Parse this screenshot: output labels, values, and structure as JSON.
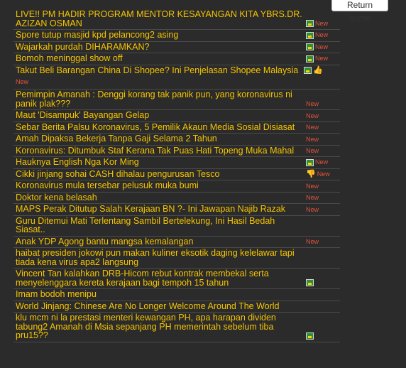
{
  "return_home": "Return home",
  "rows": [
    {
      "title": "LIVE!! PM HADIR PROGRAM MENTOR KESAYANGAN KITA YBRS.DR. AZIZAN OSMAN",
      "icon": "picture-icon",
      "new": "New"
    },
    {
      "title": "Spore tutup masjid kpd pelancong2 asing",
      "icon": "picture-icon",
      "new": "New"
    },
    {
      "title": "Wajarkah purdah DIHARAMKAN?",
      "icon": "picture-icon",
      "new": "New"
    },
    {
      "title": "Bomoh meninggal show off",
      "icon": "picture-icon",
      "new": "New"
    },
    {
      "title": "Takut Beli Barangan China Di Shopee? Ini Penjelasan Shopee Malaysia",
      "icon": "picture-icon",
      "icon2": "thumbs-up-icon",
      "new": "New"
    },
    {
      "title": "Pemimpin Amanah : Denggi korang tak panik pun, yang koronavirus ni panik plak???",
      "new": "New"
    },
    {
      "title": "Maut 'Disampuk' Bayangan Gelap",
      "new": "New"
    },
    {
      "title": "Sebar Berita Palsu Koronavirus, 5 Pemilik Akaun Media Sosial Disiasat",
      "new": "New"
    },
    {
      "title": "Amah Dipaksa Bekerja Tanpa Gaji Selama 2 Tahun",
      "new": "New"
    },
    {
      "title": "Koronavirus: Ditumbuk Staf Kerana Tak Puas Hati Topeng Muka Mahal",
      "new": "New"
    },
    {
      "title": "Hauknya English Nga Kor Ming",
      "icon": "picture-icon",
      "new": "New"
    },
    {
      "title": "Cikki jinjang sohai CASH dihalau pengurusan Tesco",
      "icon": "thumbs-down-icon",
      "new": "New"
    },
    {
      "title": "Koronavirus mula tersebar pelusuk muka bumi",
      "new": "New"
    },
    {
      "title": "Doktor kena belasah",
      "new": "New"
    },
    {
      "title": "MAPS Perak Ditutup Salah Kerajaan BN ?- Ini Jawapan Najib Razak",
      "new": "New"
    },
    {
      "title": "Guru Ditemui Mati Terlentang Sambil Bertelekung, Ini Hasil Bedah Siasat.."
    },
    {
      "title": "Anak YDP Agong bantu mangsa kemalangan",
      "new": "New"
    },
    {
      "title": "haibat presiden jokowi pun makan kuliner eksotik daging kelelawar tapi tiada kena virus apa2 langsung"
    },
    {
      "title": "Vincent Tan kalahkan DRB-Hicom rebut kontrak membekal serta menyelenggara kereta kerajaan bagi tempoh 15 tahun",
      "icon": "picture-icon"
    },
    {
      "title": "Imam bodoh menipu"
    },
    {
      "title": "World Jinjang: Chinese Are No Longer Welcome Around The World"
    },
    {
      "title": "klu mcm ni la prestasi menteri kewangan PH, apa harapan dividen tabung2 Amanah di Msia sepanjang PH memerintah sebelum tiba pru15??",
      "icon": "picture-icon"
    }
  ]
}
